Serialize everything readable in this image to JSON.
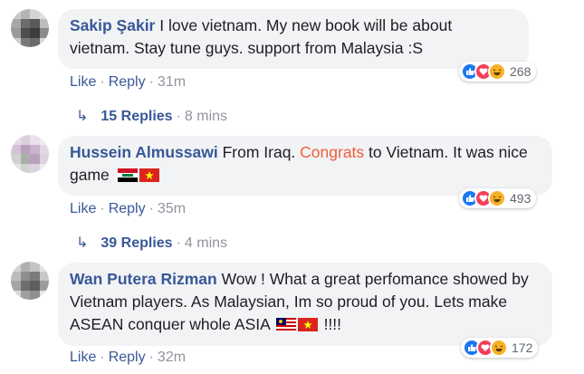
{
  "comments": [
    {
      "author": "Sakip Şakir",
      "text_before": " I love vietnam. My new book will be about vietnam. Stay tune guys. support from Malaysia :S",
      "highlight": "",
      "text_after": "",
      "reaction_count": "268",
      "like": "Like",
      "reply": "Reply",
      "time": "31m",
      "replies_label": "15 Replies",
      "replies_time": "8 mins"
    },
    {
      "author": "Hussein Almussawi",
      "text_before": " From Iraq. ",
      "highlight": "Congrats",
      "text_after": " to Vietnam. It was nice game",
      "reaction_count": "493",
      "like": "Like",
      "reply": "Reply",
      "time": "35m",
      "replies_label": "39 Replies",
      "replies_time": "4 mins"
    },
    {
      "author": "Wan Putera Rizman",
      "text_before": " Wow ! What a great perfomance showed by Vietnam players. As Malaysian, Im so proud of you. Lets make ASEAN conquer whole ASIA",
      "highlight": "",
      "text_after": " !!!!",
      "reaction_count": "172",
      "like": "Like",
      "reply": "Reply",
      "time": "32m"
    }
  ],
  "icons": {
    "like": "like-icon",
    "love": "love-icon",
    "haha": "haha-icon",
    "reply_arrow": "reply-arrow-icon"
  },
  "colors": {
    "author": "#385898",
    "highlight": "#f15c3a",
    "like_blue": "#1877f2",
    "love_red": "#f33e58",
    "haha_yellow": "#f7b125"
  }
}
